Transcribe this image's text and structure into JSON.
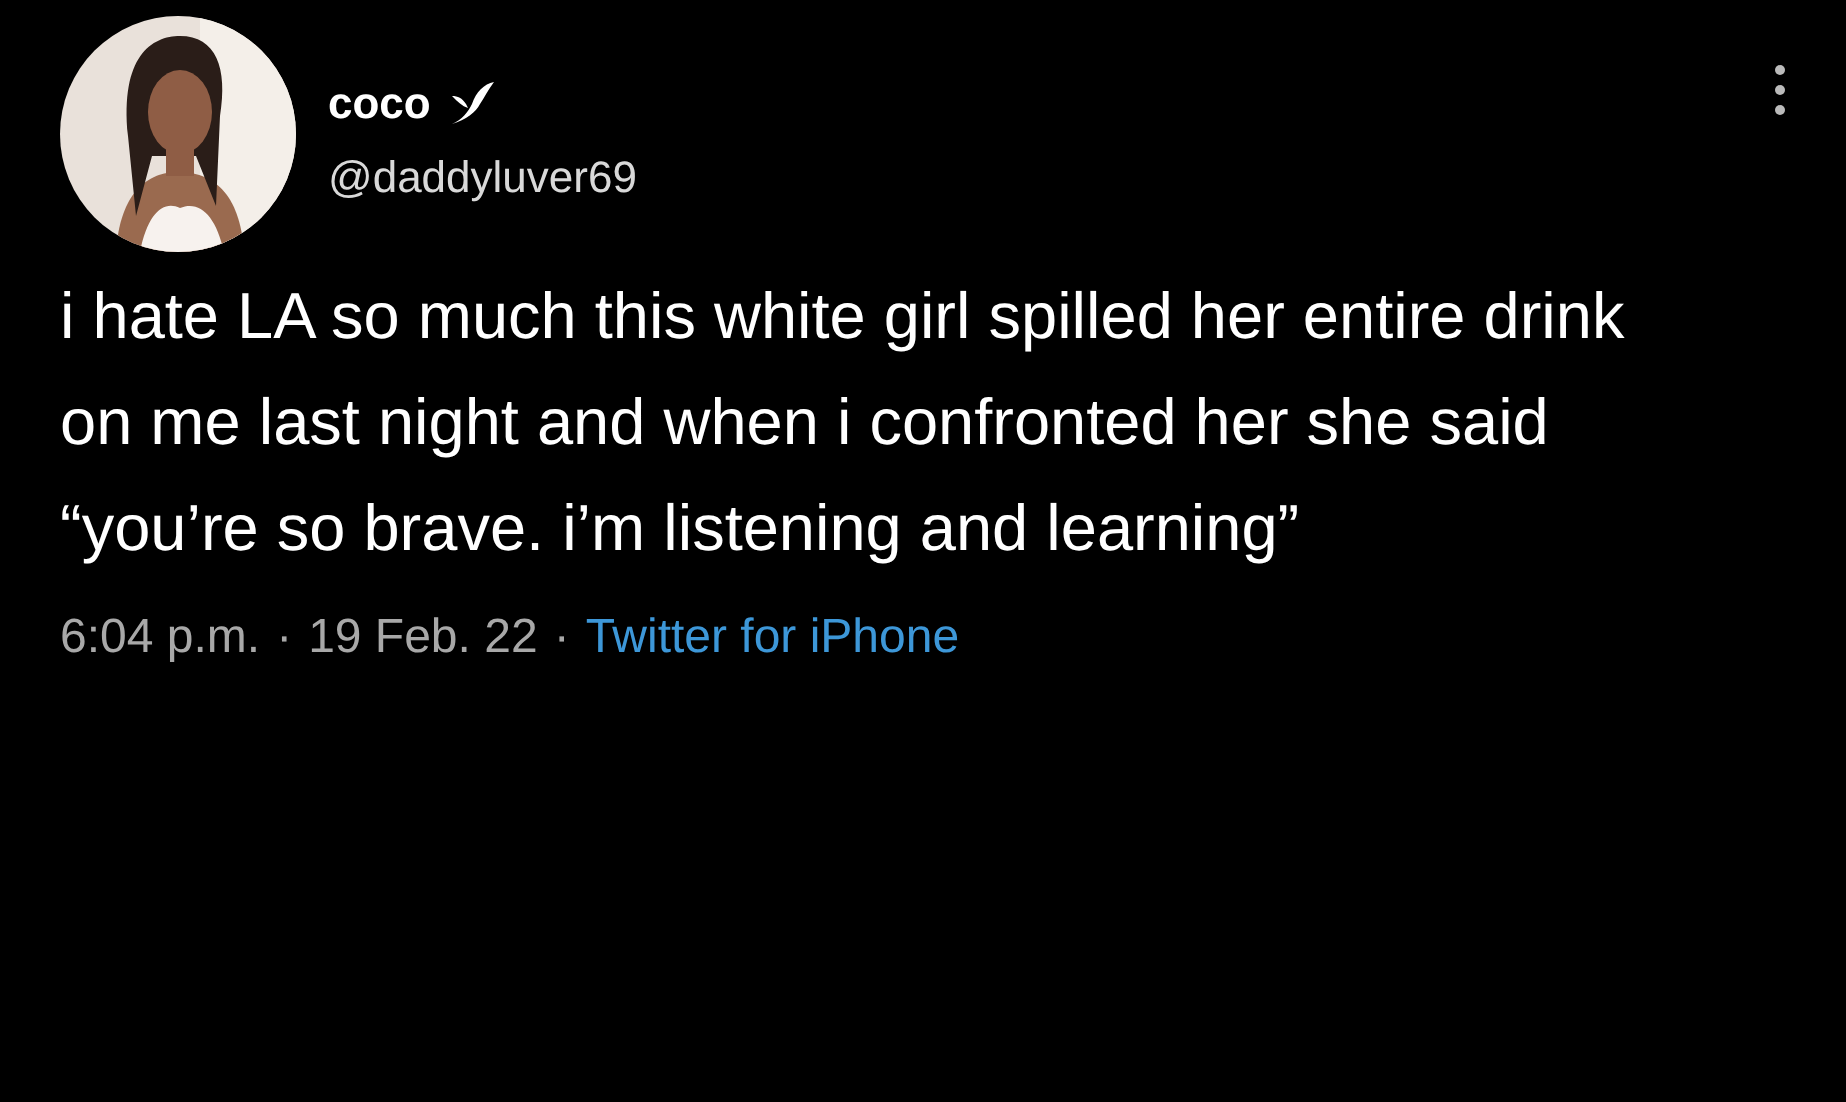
{
  "tweet": {
    "author": {
      "name": "coco",
      "handle": "@daddyluver69"
    },
    "text": "i hate LA so much this white girl spilled her entire drink on me last night and when i confronted her she said “you’re so brave. i’m listening and learning”",
    "footer": [
      {
        "kind": "meta",
        "text": "6:04 p.m."
      },
      {
        "kind": "separator",
        "text": "·"
      },
      {
        "kind": "meta",
        "text": "19 Feb. 22"
      },
      {
        "kind": "separator",
        "text": "·"
      },
      {
        "kind": "link",
        "text": "Twitter for iPhone"
      }
    ]
  }
}
